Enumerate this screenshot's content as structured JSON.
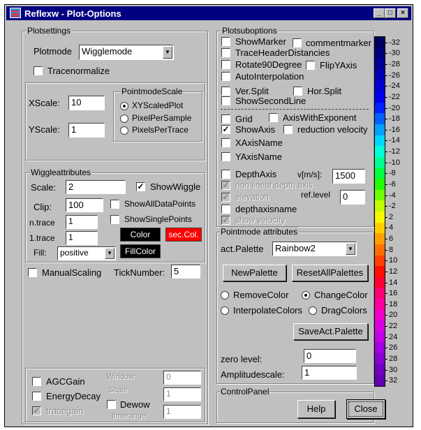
{
  "window": {
    "title": "Reflexw  - Plot-Options",
    "min_label": "_",
    "max_label": "□",
    "close_label": "×"
  },
  "plotsettings": {
    "legend": "Plotsettings",
    "plotmode_label": "Plotmode",
    "plotmode_value": "Wigglemode",
    "tracenormalize_label": "Tracenormalize",
    "tracenormalize_checked": false,
    "xscale_label": "XScale:",
    "xscale_value": "10",
    "yscale_label": "YScale:",
    "yscale_value": "1",
    "pointmode_scale": {
      "legend": "PointmodeScale",
      "options": [
        "XYScaledPlot",
        "PixelPerSample",
        "PixelsPerTrace"
      ],
      "selected": "XYScaledPlot"
    }
  },
  "wiggle": {
    "legend": "Wiggleattributes",
    "scale_label": "Scale:",
    "scale_value": "2",
    "showwiggle_label": "ShowWiggle",
    "showwiggle_checked": true,
    "clip_label": "Clip:",
    "clip_value": "100",
    "showalldatapoints_label": "ShowAllDataPoints",
    "showsinglepoints_label": "ShowSinglePoints",
    "ntrace_label": "n.trace",
    "ntrace_value": "1",
    "first_trace_label": "1.trace",
    "first_trace_value": "1",
    "color_button": "Color",
    "sec_col_button": "sec.Col.",
    "fill_label": "Fill:",
    "fill_value": "positive",
    "fillcolor_button": "FillColor",
    "color_black": "#000000",
    "sec_col_color": "#ff0000"
  },
  "scaling": {
    "manualscaling_label": "ManualScaling",
    "ticknumber_label": "TickNumber:",
    "ticknumber_value": "5"
  },
  "gain": {
    "agcgain_label": "AGCGain",
    "energydecay_label": "EnergyDecay",
    "tracegain_label": "tracegain",
    "window_label": "Window:",
    "window_value": "0",
    "scale_label": "Scale:",
    "scale_value": "1",
    "dewow_label": "Dewow",
    "timerange_label": "timerange:",
    "timerange_value": "1"
  },
  "plotsuboptions": {
    "legend": "Plotsuboptions",
    "showmarker": "ShowMarker",
    "commentmarker": "commentmarker",
    "traceheaderdistancies": "TraceHeaderDistancies",
    "rotate90degree": "Rotate90Degree",
    "flipyaxis": "FlipYAxis",
    "autointerpolation": "AutoInterpolation",
    "versplit": "Ver.Split",
    "horsplit": "Hor.Split",
    "showsecondline": "ShowSecondLine",
    "grid": "Grid",
    "axiswithexponent": "AxisWithExponent",
    "showaxis": "ShowAxis",
    "showaxis_checked": true,
    "reductionvelocity": "reduction velocity",
    "xaxisname": "XAxisName",
    "yaxisname": "YAxisName",
    "depthaxis": "DepthAxis",
    "vms_label": "v[m/s]:",
    "vms_value": "1500",
    "nonlineardepthaxis": "non linear depth axis",
    "elevation": "elevation",
    "reflevel_label": "ref.level",
    "reflevel_value": "0",
    "depthaxisname": "depthaxisname",
    "showvelocity": "show velocity"
  },
  "pointmode": {
    "legend": "Pointmode attributes",
    "actpalette_label": "act.Palette",
    "actpalette_value": "Rainbow2",
    "newpalette_button": "NewPalette",
    "resetallpalettes_button": "ResetAllPalettes",
    "removecolor": "RemoveColor",
    "changecolor": "ChangeColor",
    "interpolatecolors": "InterpolateColors",
    "dragcolors": "DragColors",
    "color_mode_selected": "ChangeColor",
    "saveactpalette_button": "SaveAct.Palette",
    "zerolevel_label": "zero level:",
    "zerolevel_value": "0",
    "amplitudescale_label": "Amplitudescale:",
    "amplitudescale_value": "1"
  },
  "controlpanel": {
    "legend": "ControlPanel",
    "help_button": "Help",
    "close_button": "Close"
  },
  "palette": {
    "labels": [
      "-32",
      "-30",
      "-28",
      "-26",
      "-24",
      "-22",
      "-20",
      "-18",
      "-16",
      "-14",
      "-12",
      "-10",
      "-8",
      "-6",
      "-4",
      "-2",
      "2",
      "4",
      "6",
      "8",
      "10",
      "12",
      "14",
      "16",
      "18",
      "20",
      "22",
      "24",
      "26",
      "28",
      "30",
      "32"
    ],
    "colors": [
      "#000060",
      "#00007a",
      "#000096",
      "#0000b4",
      "#0000d2",
      "#0000f0",
      "#0020ff",
      "#0060ff",
      "#00a0ff",
      "#00d8ff",
      "#00ffd8",
      "#00ff90",
      "#00ff40",
      "#20ff00",
      "#70ff00",
      "#c0ff00",
      "#f8f800",
      "#ffd000",
      "#ffa000",
      "#ff7000",
      "#ff4000",
      "#ff1000",
      "#ff0030",
      "#ff0070",
      "#ff00a0",
      "#f000c8",
      "#d800e0",
      "#c000e8",
      "#a000e0",
      "#8800d0",
      "#7000c0",
      "#6000b0"
    ]
  }
}
